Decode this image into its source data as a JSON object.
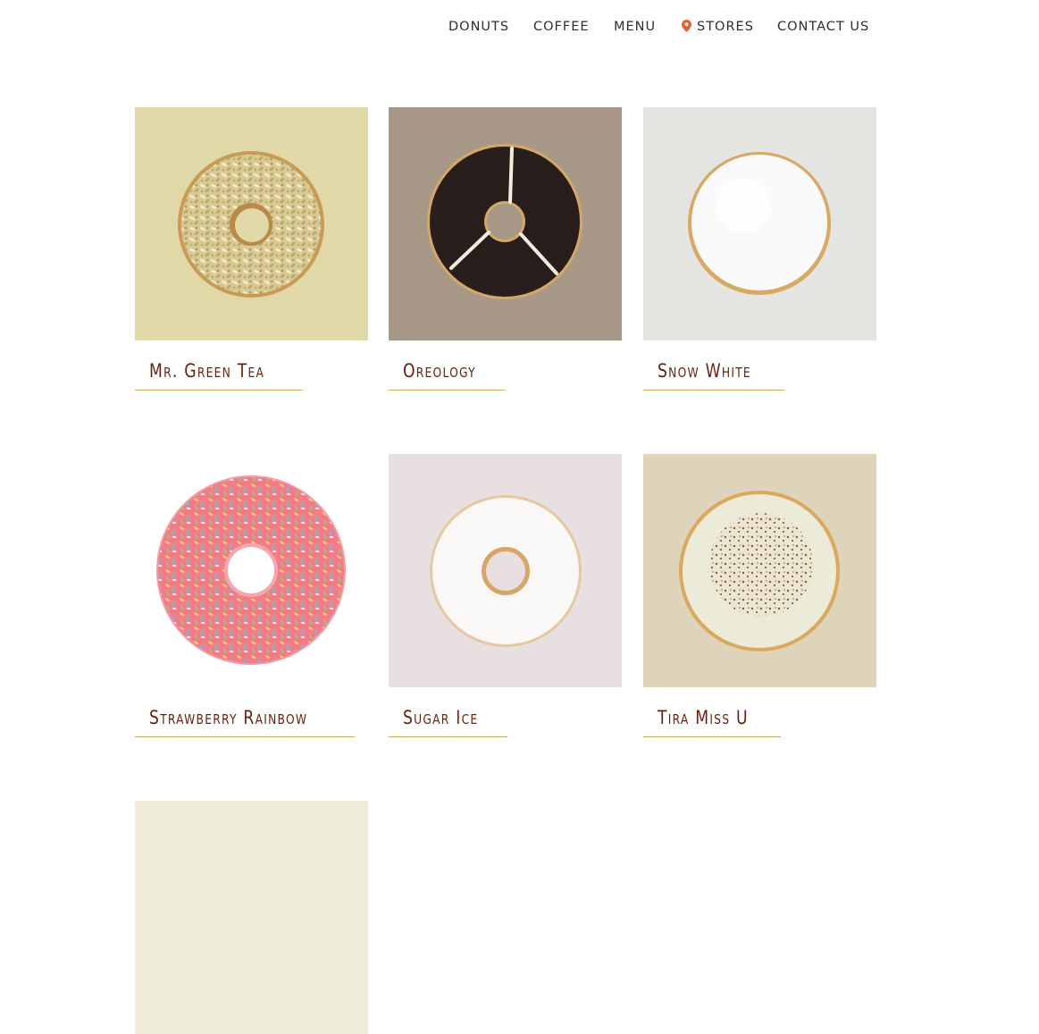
{
  "nav": {
    "items": [
      {
        "label": "DONUTS"
      },
      {
        "label": "COFFEE"
      },
      {
        "label": "MENU"
      },
      {
        "label": "STORES",
        "icon": "map-pin-icon"
      },
      {
        "label": "CONTACT US"
      }
    ],
    "pin_color": "#e8622c"
  },
  "products": [
    {
      "name": "Mr. Green Tea",
      "bg": "#e0d8a6"
    },
    {
      "name": "Oreology",
      "bg": "#a89888"
    },
    {
      "name": "Snow White",
      "bg": "#e4e4e0"
    },
    {
      "name": "Strawberry Rainbow",
      "bg": "#ffffff"
    },
    {
      "name": "Sugar Ice",
      "bg": "#e8e0e0"
    },
    {
      "name": "Tira Miss U",
      "bg": "#ddd4bb"
    },
    {
      "name": "",
      "bg": "#efecdc"
    }
  ],
  "colors": {
    "title": "#6b1e0b",
    "underline": "#c9a85a",
    "nav_text": "#2d2d2d"
  }
}
